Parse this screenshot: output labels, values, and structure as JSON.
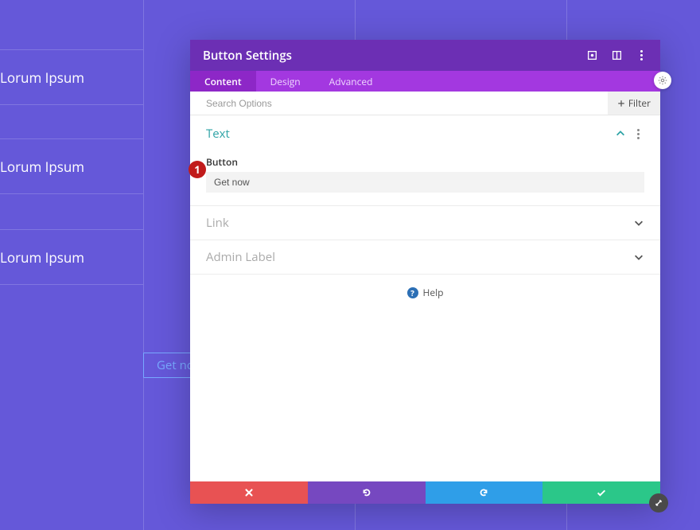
{
  "background": {
    "rows": [
      "Lorum Ipsum",
      "Lorum Ipsum",
      "Lorum Ipsum"
    ],
    "button_label": "Get no"
  },
  "modal": {
    "title": "Button Settings",
    "tabs": {
      "content": "Content",
      "design": "Design",
      "advanced": "Advanced"
    },
    "search": {
      "placeholder": "Search Options",
      "filter_label": "Filter"
    },
    "sections": {
      "text": {
        "title": "Text",
        "field_label": "Button",
        "value": "Get now"
      },
      "link": {
        "title": "Link"
      },
      "admin": {
        "title": "Admin Label"
      }
    },
    "help_label": "Help"
  },
  "annotation": {
    "num": "1"
  }
}
